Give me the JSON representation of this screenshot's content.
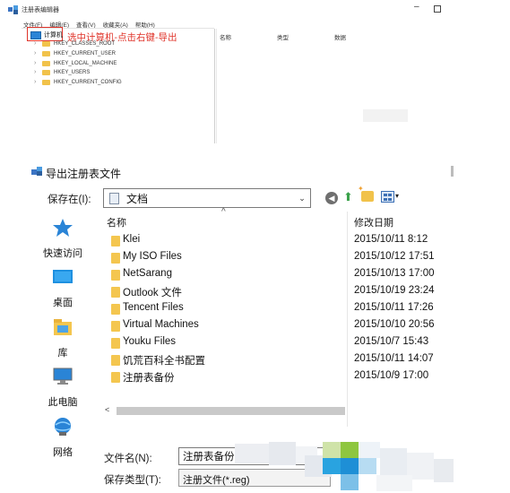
{
  "registry": {
    "title": "注册表编辑器",
    "menu": [
      "文件(F)",
      "编辑(E)",
      "查看(V)",
      "收藏夹(A)",
      "帮助(H)"
    ],
    "root": "计算机",
    "annotation": "选中计算机-点击右键-导出",
    "keys": [
      "HKEY_CLASSES_ROOT",
      "HKEY_CURRENT_USER",
      "HKEY_LOCAL_MACHINE",
      "HKEY_USERS",
      "HKEY_CURRENT_CONFIG"
    ],
    "columns": [
      "名称",
      "类型",
      "数据"
    ]
  },
  "dialog": {
    "title": "导出注册表文件",
    "save_in_label": "保存在(I):",
    "save_in_value": "文档",
    "places": [
      "快速访问",
      "桌面",
      "库",
      "此电脑",
      "网络"
    ],
    "list_header_name": "名称",
    "list_header_date": "修改日期",
    "files": [
      {
        "name": "Klei",
        "date": "2015/10/11 8:12"
      },
      {
        "name": "My ISO Files",
        "date": "2015/10/12 17:51"
      },
      {
        "name": "NetSarang",
        "date": "2015/10/13 17:00"
      },
      {
        "name": "Outlook 文件",
        "date": "2015/10/19 23:24"
      },
      {
        "name": "Tencent Files",
        "date": "2015/10/11 17:26"
      },
      {
        "name": "Virtual Machines",
        "date": "2015/10/10 20:56"
      },
      {
        "name": "Youku Files",
        "date": "2015/10/7 15:43"
      },
      {
        "name": "饥荒百科全书配置",
        "date": "2015/10/11 14:07"
      },
      {
        "name": "注册表备份",
        "date": "2015/10/9 17:00"
      }
    ],
    "filename_label": "文件名(N):",
    "filename_value": "注册表备份",
    "filetype_label": "保存类型(T):",
    "filetype_value": "注册文件(*.reg)"
  },
  "colors": {
    "accent_red": "#e0342a",
    "folder_yellow": "#f4c64f",
    "place_blue": "#2a84d6"
  }
}
